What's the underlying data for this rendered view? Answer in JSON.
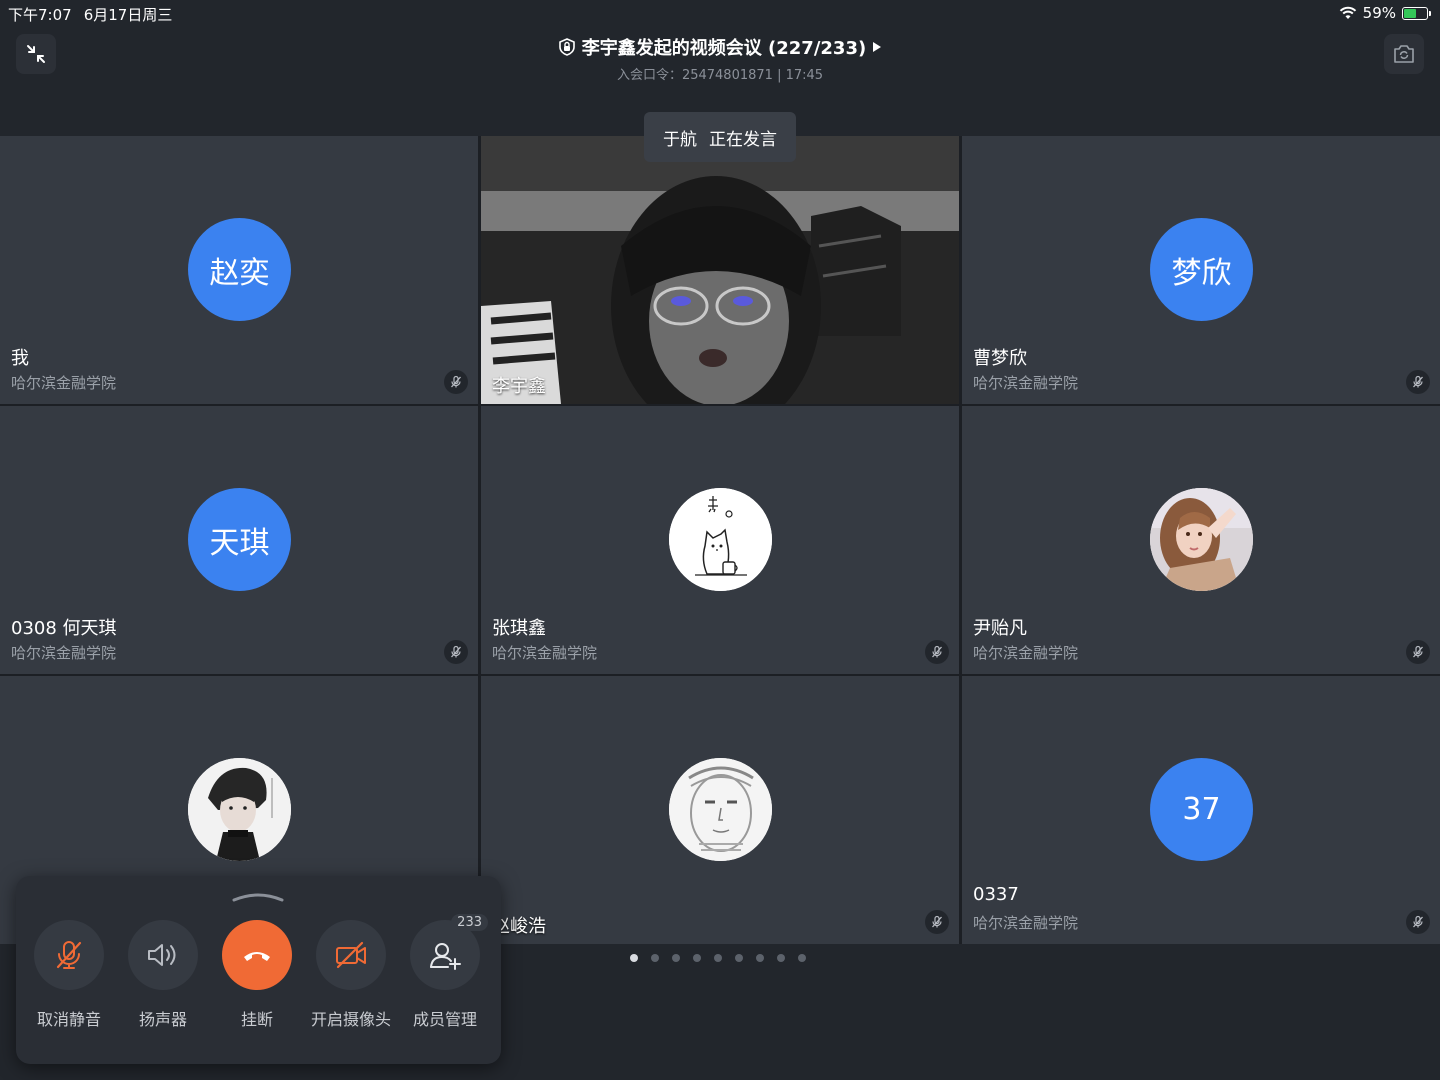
{
  "status_bar": {
    "time": "下午7:07",
    "date": "6月17日周三",
    "battery_text": "59%",
    "battery_level": 0.59
  },
  "header": {
    "title": "李宇鑫发起的视频会议 (227/233)",
    "subtitle": "入会口令：25474801871 | 17:45"
  },
  "speaking_toast": {
    "speaker": "于航",
    "status": "正在发言"
  },
  "participants": [
    {
      "avatar_text": "赵奕",
      "name": "我",
      "org": "哈尔滨金融学院",
      "muted": true
    },
    {
      "video": true,
      "name": "李宇鑫"
    },
    {
      "avatar_text": "梦欣",
      "name": "曹梦欣",
      "org": "哈尔滨金融学院",
      "muted": true
    },
    {
      "avatar_text": "天琪",
      "name": "0308 何天琪",
      "org": "哈尔滨金融学院",
      "muted": true
    },
    {
      "avatar_image": "cartoon-cat",
      "name": "张琪鑫",
      "org": "哈尔滨金融学院",
      "muted": true
    },
    {
      "avatar_image": "photo",
      "name": "尹贻凡",
      "org": "哈尔滨金融学院",
      "muted": true
    },
    {
      "avatar_image": "photo",
      "name": "",
      "org": ""
    },
    {
      "avatar_image": "sketch",
      "name": "赵峻浩",
      "muted": true
    },
    {
      "avatar_text": "37",
      "name": "0337",
      "org": "哈尔滨金融学院",
      "muted": true
    }
  ],
  "pagination": {
    "total": 9,
    "current": 1
  },
  "controls": {
    "unmute": "取消静音",
    "speaker": "扬声器",
    "hangup": "挂断",
    "camera": "开启摄像头",
    "members": "成员管理",
    "member_count": "233"
  },
  "colors": {
    "accent": "#3b82f0",
    "hangup": "#f06a35",
    "muted_icon": "#f06a35"
  }
}
